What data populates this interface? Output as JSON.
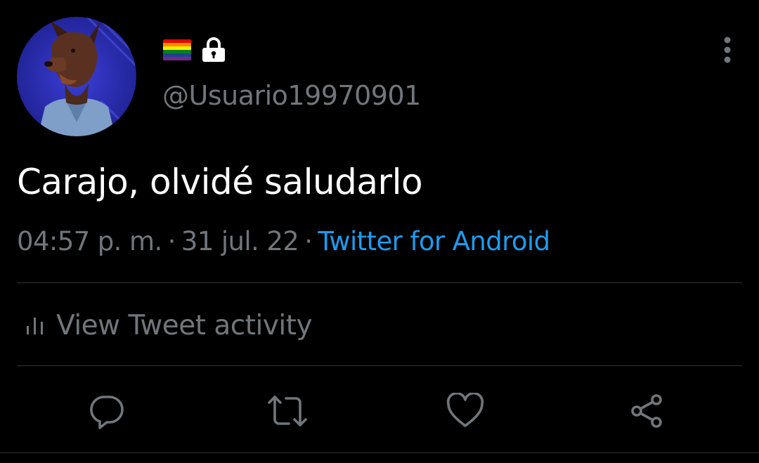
{
  "user": {
    "handle": "@Usuario19970901",
    "avatar_icon": "doberman-avatar",
    "badges": [
      "rainbow-flag-icon",
      "lock-icon"
    ]
  },
  "tweet": {
    "text": "Carajo, olvidé saludarlo",
    "time": "04:57 p. m.",
    "separator": "·",
    "date": "31 jul. 22",
    "source": "Twitter for Android"
  },
  "activity": {
    "label": "View Tweet activity",
    "icon": "bar-chart-icon"
  },
  "actions": [
    {
      "name": "reply",
      "icon": "reply-icon"
    },
    {
      "name": "retweet",
      "icon": "retweet-icon"
    },
    {
      "name": "like",
      "icon": "heart-icon"
    },
    {
      "name": "share",
      "icon": "share-icon"
    }
  ],
  "colors": {
    "background": "#000000",
    "text": "#ffffff",
    "secondary": "#71767b",
    "link": "#1d9bf0",
    "divider": "#2f3336"
  }
}
